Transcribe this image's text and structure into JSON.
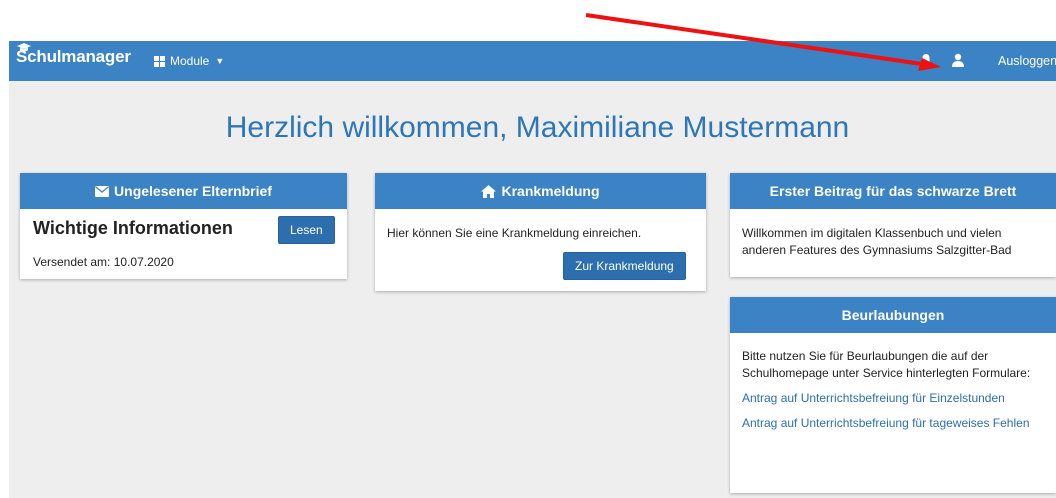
{
  "header": {
    "brand": "Schulmanager",
    "module_label": "Module",
    "logout_label": "Ausloggen",
    "icons": {
      "brand": "graduation-cap-icon",
      "modules": "grid-icon",
      "notifications": "bell-icon",
      "account": "user-icon"
    }
  },
  "welcome": "Herzlich willkommen, Maximiliane Mustermann",
  "cards": {
    "letter": {
      "header": "Ungelesener Elternbrief",
      "icon": "envelope-icon",
      "title": "Wichtige Informationen",
      "button": "Lesen",
      "sent": "Versendet am: 10.07.2020"
    },
    "sick": {
      "header": "Krankmeldung",
      "icon": "home-icon",
      "text": "Hier können Sie eine Krankmeldung einreichen.",
      "button": "Zur Krankmeldung"
    },
    "board": {
      "header": "Erster Beitrag für das schwarze Brett",
      "text": "Willkommen im digitalen Klassenbuch und vielen anderen Features  des Gymnasiums Salzgitter-Bad"
    },
    "leave": {
      "header": "Beurlaubungen",
      "text": "Bitte nutzen Sie für Beurlaubungen die auf der Schulhomepage unter Service hinterlegten Formulare:",
      "link1": "Antrag auf Unterrichtsbefreiung für Einzelstunden",
      "link2": "Antrag auf Unterrichtsbefreiung für tageweises Fehlen"
    }
  },
  "colors": {
    "navbar": "#3b83c4",
    "heading": "#2d76b7",
    "background": "#eeeeee",
    "button": "#2d6fae",
    "annotation_arrow": "#ee1111"
  }
}
